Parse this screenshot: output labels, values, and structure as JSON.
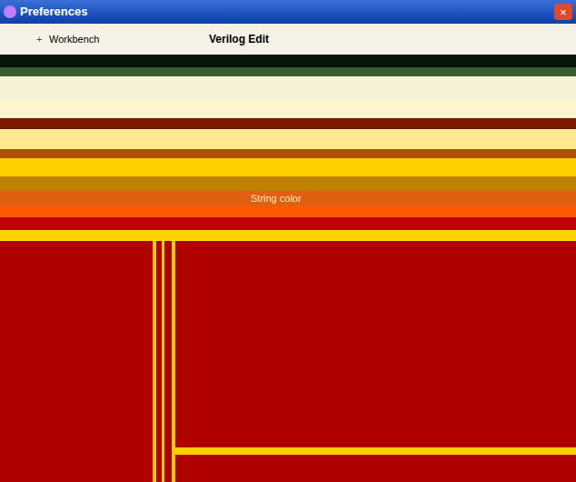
{
  "window": {
    "title": "Preferences",
    "close": "×"
  },
  "tree": {
    "items": [
      {
        "label": "Workbench",
        "expander": "+",
        "expanded": false
      }
    ]
  },
  "page": {
    "title": "Verilog Edit",
    "field_label": "String color"
  }
}
